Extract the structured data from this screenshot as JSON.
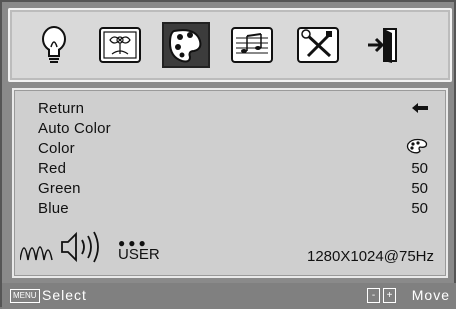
{
  "tabs": [
    {
      "icon": "lightbulb-icon"
    },
    {
      "icon": "picture-icon"
    },
    {
      "icon": "color-palette-icon",
      "active": true
    },
    {
      "icon": "audio-icon"
    },
    {
      "icon": "tools-icon"
    },
    {
      "icon": "exit-icon"
    }
  ],
  "menu": {
    "items": [
      {
        "label": "Return",
        "value": ""
      },
      {
        "label": "Auto Color",
        "value": ""
      },
      {
        "label": "Color",
        "value": ""
      },
      {
        "label": "Red",
        "value": "50"
      },
      {
        "label": "Green",
        "value": "50"
      },
      {
        "label": "Blue",
        "value": "50"
      }
    ]
  },
  "info": {
    "dots": "●●●",
    "mode": "USER",
    "resolution": "1280X1024@75Hz"
  },
  "footer": {
    "menu_key": "MENU",
    "select_label": "Select",
    "minus_key": "-",
    "plus_key": "+",
    "move_label": "Move"
  },
  "colors": {
    "active_tab": "#3c3c3c",
    "panel": "#cfcfcf"
  }
}
